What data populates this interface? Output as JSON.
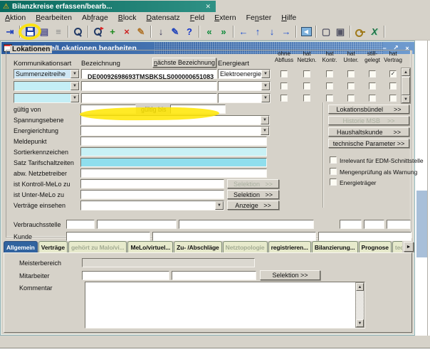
{
  "colors": {
    "teal_bar": "#0a6a5e",
    "titlebar_blue": "#2b5b9e",
    "highlight_yellow": "#ffe600",
    "cyan_light": "#c9f1f5",
    "cyan_dark": "#8fdeed",
    "tab_active_blue": "#31639f",
    "window_gray": "#d6d2c9"
  },
  "window": {
    "tab_title": "Bilanzkreise erfassen/bearb...",
    "close_glyph": "✕"
  },
  "menubar": {
    "items": [
      {
        "label": "Aktion",
        "accel_index": 0
      },
      {
        "label": "Bearbeiten",
        "accel_index": 0
      },
      {
        "label": "Abfrage",
        "accel_index": 2
      },
      {
        "label": "Block",
        "accel_index": 0
      },
      {
        "label": "Datensatz",
        "accel_index": 0
      },
      {
        "label": "Feld",
        "accel_index": 0
      },
      {
        "label": "Extern",
        "accel_index": 0
      },
      {
        "label": "Fenster",
        "accel_index": 2
      },
      {
        "label": "Hilfe",
        "accel_index": 0
      }
    ]
  },
  "toolbar": {
    "items": [
      {
        "type": "icon",
        "name": "exit-icon",
        "glyph": "⇥",
        "color": "#2244bb"
      },
      {
        "type": "sep"
      },
      {
        "type": "floppy",
        "name": "save-icon"
      },
      {
        "type": "icon",
        "name": "print-icon",
        "glyph": "▤",
        "color": "#50508c"
      },
      {
        "type": "icon",
        "name": "document-icon",
        "glyph": "≡",
        "color": "#8a8a8a"
      },
      {
        "type": "sep"
      },
      {
        "type": "magnifier",
        "name": "search-icon"
      },
      {
        "type": "sep"
      },
      {
        "type": "magnifier",
        "name": "enter-query-icon",
        "badge": true
      },
      {
        "type": "icon",
        "name": "insert-record-icon",
        "glyph": "+",
        "color": "#1c8a1c"
      },
      {
        "type": "icon",
        "name": "delete-record-icon",
        "glyph": "×",
        "color": "#cc2020"
      },
      {
        "type": "icon",
        "name": "clear-record-icon",
        "glyph": "✎",
        "color": "#b0742a"
      },
      {
        "type": "sep"
      },
      {
        "type": "icon",
        "name": "duplicate-record-icon",
        "glyph": "↓",
        "color": "#333355"
      },
      {
        "type": "icon",
        "name": "edit-icon",
        "glyph": "✎",
        "color": "#2244bb"
      },
      {
        "type": "icon",
        "name": "help-icon",
        "glyph": "?",
        "color": "#1133cc"
      },
      {
        "type": "sep"
      },
      {
        "type": "icon",
        "name": "previous-block-icon",
        "glyph": "«",
        "color": "#0e8a3a"
      },
      {
        "type": "icon",
        "name": "next-block-icon",
        "glyph": "»",
        "color": "#0e8a3a"
      },
      {
        "type": "sep"
      },
      {
        "type": "icon",
        "name": "scroll-left-icon",
        "glyph": "←",
        "color": "#1d4fd0"
      },
      {
        "type": "icon",
        "name": "scroll-up-icon",
        "glyph": "↑",
        "color": "#1d4fd0"
      },
      {
        "type": "icon",
        "name": "scroll-down-icon",
        "glyph": "↓",
        "color": "#1d4fd0"
      },
      {
        "type": "icon",
        "name": "scroll-right-icon",
        "glyph": "→",
        "color": "#1d4fd0"
      },
      {
        "type": "sep"
      },
      {
        "type": "navbox",
        "name": "navigate-back-icon",
        "glyph": "◀"
      },
      {
        "type": "sep"
      },
      {
        "type": "icon",
        "name": "notes-icon",
        "glyph": "▢",
        "color": "#555566"
      },
      {
        "type": "icon",
        "name": "attachments-icon",
        "glyph": "▣",
        "color": "#555566"
      },
      {
        "type": "sep"
      },
      {
        "type": "key",
        "name": "key-icon"
      },
      {
        "type": "icon",
        "name": "excel-export-icon",
        "glyph": "X",
        "color": "#1e7145"
      },
      {
        "type": "sep"
      }
    ]
  },
  "dialog": {
    "title": "Zählpunkte/Lokationen bearbeiten",
    "minimize_glyph": "−",
    "restore_glyph": "↗",
    "close_glyph": "×"
  },
  "lokationen": {
    "group_label": "Lokationen",
    "kommunikationsart_label": "Kommunikationsart",
    "bezeichnung_label": "Bezeichnung",
    "energieart_label": "Energieart",
    "next_bezeichnung_button": {
      "label": "nächste Bezeichnung",
      "accel_index": 0
    },
    "checkbox_columns": [
      [
        "ohne",
        "Abfluss"
      ],
      [
        "hat",
        "Netzkn."
      ],
      [
        "hat",
        "Kontr."
      ],
      [
        "hat",
        "Unter."
      ],
      [
        "still-",
        "gelegt"
      ],
      [
        "hat",
        "Vertrag"
      ]
    ],
    "rows": [
      {
        "kommunikationsart": "Summenzeitreihe",
        "bezeichnung": "DE00092698693TMSBKSLS000000651083",
        "energieart": "Elektroenergie",
        "checks": [
          false,
          false,
          false,
          false,
          false,
          true
        ]
      },
      {
        "kommunikationsart": "",
        "bezeichnung": "",
        "energieart": "",
        "checks": [
          false,
          false,
          false,
          false,
          false,
          false
        ]
      },
      {
        "kommunikationsart": "",
        "bezeichnung": "",
        "energieart": "",
        "checks": [
          false,
          false,
          false,
          false,
          false,
          false
        ]
      }
    ],
    "fields": {
      "gueltig_von_label": "gültig von",
      "gueltig_bis_label": "gültig bis",
      "spannungsebene_label": "Spannungsebene",
      "energierichtung_label": "Energierichtung",
      "meldepunkt_label": "Meldepunkt",
      "sortierkennzeichen_label": "Sortierkennzeichen",
      "satz_tarifschaltzeiten_label": "Satz Tarifschaltzeiten",
      "abw_netzbetreiber_label": "abw. Netzbetreiber",
      "ist_kontroll_melo_label": "ist Kontroll-MeLo zu",
      "ist_unter_melo_label": "ist Unter-MeLo zu",
      "vertraege_einsehen_label": "Verträge einsehen",
      "verbrauchsstelle_label": "Verbrauchsstelle",
      "kunde_label": "Kunde"
    },
    "buttons": {
      "selektion_disabled": "Selektion   >>",
      "selektion": "Selektion   >>",
      "anzeige": "Anzeige   >>",
      "lokationsbuendel": "Lokationsbündel      >>",
      "historie_msb": "Historie MSB    >>",
      "haushaltskunde": "Haushaltskunde      >>",
      "technische_parameter": "technische Parameter >>"
    },
    "right_checkboxes": [
      "Irrelevant für EDM-Schnittstelle",
      "Mengenprüfung als Warnung",
      "Energieträger"
    ]
  },
  "tabs": [
    {
      "label": "Allgemein",
      "state": "active"
    },
    {
      "label": "Verträge",
      "state": "normal"
    },
    {
      "label": "gehört zu Malo/vi...",
      "state": "disabled"
    },
    {
      "label": "MeLo/virtuel...",
      "state": "normal"
    },
    {
      "label": "Zu- /Abschläge",
      "state": "normal"
    },
    {
      "label": "Netztopologie",
      "state": "disabled"
    },
    {
      "label": "registrieren...",
      "state": "normal"
    },
    {
      "label": "Bilanzierung...",
      "state": "normal"
    },
    {
      "label": "Prognose",
      "state": "normal"
    },
    {
      "label": "technische Z...",
      "state": "disabled"
    }
  ],
  "tab_panel": {
    "meisterbereich_label": "Meisterbereich",
    "mitarbeiter_label": "Mitarbeiter",
    "kommentar_label": "Kommentar",
    "selektion_button": "Selektion >>"
  }
}
